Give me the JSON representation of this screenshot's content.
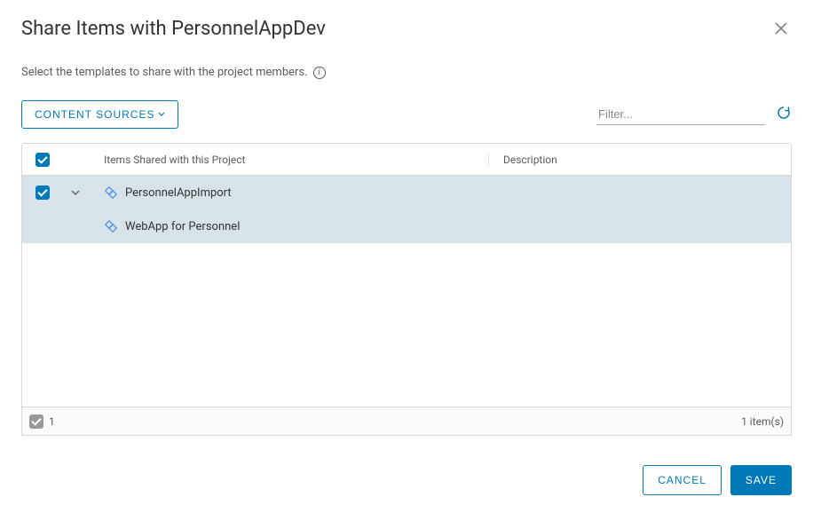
{
  "dialog": {
    "title": "Share Items with PersonnelAppDev",
    "subtitle": "Select the templates to share with the project members."
  },
  "toolbar": {
    "content_sources_label": "CONTENT SOURCES",
    "filter_placeholder": "Filter..."
  },
  "table": {
    "columns": {
      "name": "Items Shared with this Project",
      "description": "Description"
    },
    "rows": [
      {
        "name": "PersonnelAppImport",
        "description": "",
        "checked": true,
        "expanded": true
      },
      {
        "name": "WebApp for Personnel",
        "description": "",
        "child": true
      }
    ]
  },
  "footer": {
    "selected_count": "1",
    "item_count_label": "1 item(s)"
  },
  "buttons": {
    "cancel": "CANCEL",
    "save": "SAVE"
  }
}
